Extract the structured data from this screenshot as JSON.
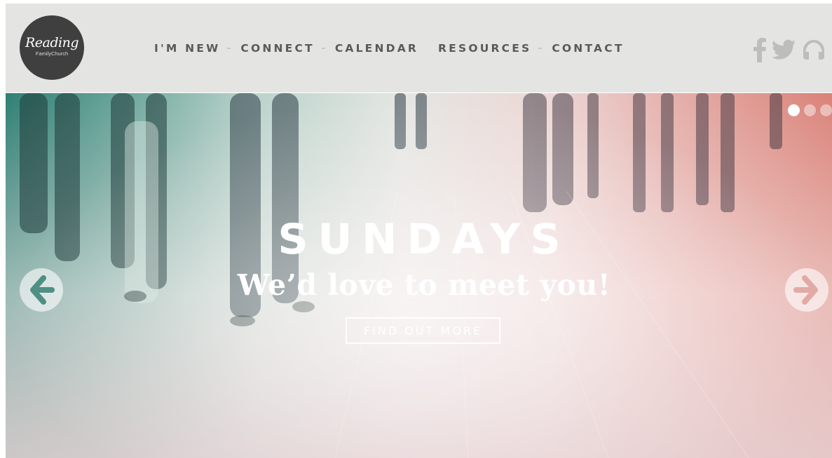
{
  "header": {
    "logo": {
      "script_text": "Reading",
      "sub_text": "FamilyChurch"
    },
    "nav": [
      {
        "label": "I'M NEW",
        "has_separator": true
      },
      {
        "label": "CONNECT",
        "has_separator": true
      },
      {
        "label": "CALENDAR",
        "has_separator": false
      },
      {
        "label": "RESOURCES",
        "has_separator": true
      },
      {
        "label": "CONTACT",
        "has_separator": false
      }
    ],
    "social_icons": [
      "facebook-icon",
      "twitter-icon",
      "headphones-icon"
    ],
    "social_color": "#bdbdbd"
  },
  "hero": {
    "headline": "SUNDAYS",
    "subheadline": "We’d love to meet you!",
    "cta_label": "FIND OUT MORE",
    "slides": 3,
    "active_slide": 1,
    "prev_icon": "arrow-left-icon",
    "next_icon": "arrow-right-icon"
  },
  "colors": {
    "header_bg": "#e4e4e3",
    "nav_text": "#5a5a5a",
    "logo_bg": "#3f3f3f",
    "hero_left": "#2f7f74",
    "hero_right": "#d98278"
  }
}
